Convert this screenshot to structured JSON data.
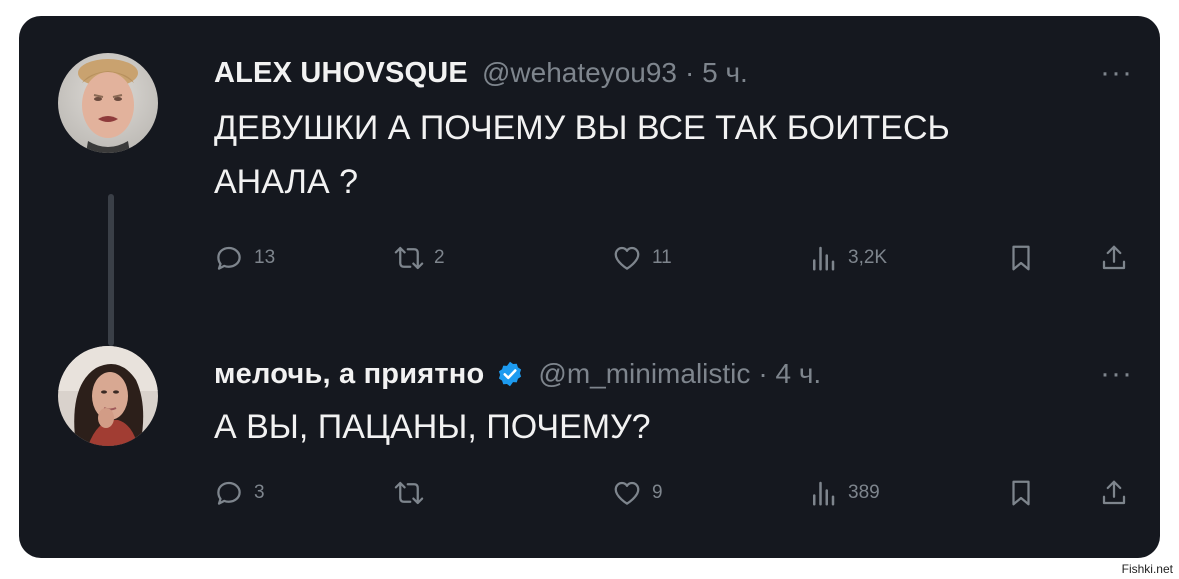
{
  "watermark": "Fishki.net",
  "tweets": [
    {
      "name": "ALEX UHOVSQUE",
      "handle": "@wehateyou93",
      "time": "· 5 ч.",
      "verified": false,
      "more": "···",
      "text": "ДЕВУШКИ А ПОЧЕМУ ВЫ ВСЕ ТАК БОИТЕСЬ\nАНАЛА ?",
      "stats": {
        "replies": "13",
        "retweets": "2",
        "likes": "11",
        "views": "3,2K"
      },
      "icons": [
        "reply-icon",
        "retweet-icon",
        "like-icon",
        "views-icon",
        "bookmark-icon",
        "share-icon"
      ]
    },
    {
      "name": "мелочь, а приятно",
      "handle": "@m_minimalistic",
      "time": "· 4 ч.",
      "verified": true,
      "more": "···",
      "text": "А ВЫ, ПАЦАНЫ, ПОЧЕМУ?",
      "stats": {
        "replies": "3",
        "retweets": "",
        "likes": "9",
        "views": "389"
      },
      "icons": [
        "reply-icon",
        "retweet-icon",
        "like-icon",
        "views-icon",
        "bookmark-icon",
        "share-icon"
      ]
    }
  ],
  "colors": {
    "card_bg": "#15181f",
    "text_primary": "#f2f2f2",
    "text_secondary": "#7e858d",
    "verified_badge": "#1d9bf0"
  }
}
